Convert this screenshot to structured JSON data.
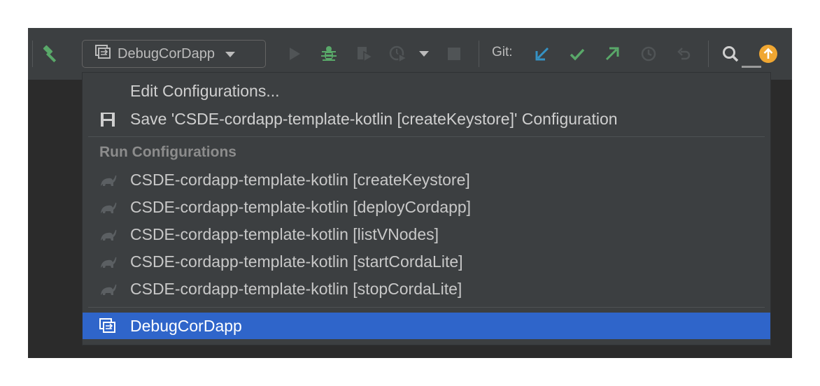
{
  "toolbar": {
    "build_icon": "hammer-icon",
    "run_config": {
      "label": "DebugCorDapp",
      "icon": "configuration-icon"
    },
    "actions": [
      "run-icon",
      "debug-icon",
      "coverage-icon",
      "profile-icon",
      "more-dropdown-icon",
      "stop-icon"
    ],
    "git_label": "Git:",
    "git_actions": [
      "update-project-icon",
      "commit-icon",
      "push-icon",
      "history-icon",
      "rollback-icon"
    ],
    "search_icon": "search-icon",
    "update_icon": "update-available-icon"
  },
  "dropdown": {
    "edit_label": "Edit Configurations...",
    "save_label": "Save 'CSDE-cordapp-template-kotlin [createKeystore]' Configuration",
    "section_title": "Run Configurations",
    "items": [
      {
        "label": "CSDE-cordapp-template-kotlin [createKeystore]",
        "icon": "gradle-icon"
      },
      {
        "label": "CSDE-cordapp-template-kotlin [deployCordapp]",
        "icon": "gradle-icon"
      },
      {
        "label": "CSDE-cordapp-template-kotlin [listVNodes]",
        "icon": "gradle-icon"
      },
      {
        "label": "CSDE-cordapp-template-kotlin [startCordaLite]",
        "icon": "gradle-icon"
      },
      {
        "label": "CSDE-cordapp-template-kotlin [stopCordaLite]",
        "icon": "gradle-icon"
      }
    ],
    "selected": {
      "label": "DebugCorDapp",
      "icon": "configuration-icon"
    }
  },
  "colors": {
    "toolbar_bg": "#3c3f41",
    "editor_bg": "#2b2b2b",
    "selection": "#2f65ca",
    "green": "#59a869",
    "blue": "#3592c4",
    "orange": "#f0a732"
  }
}
